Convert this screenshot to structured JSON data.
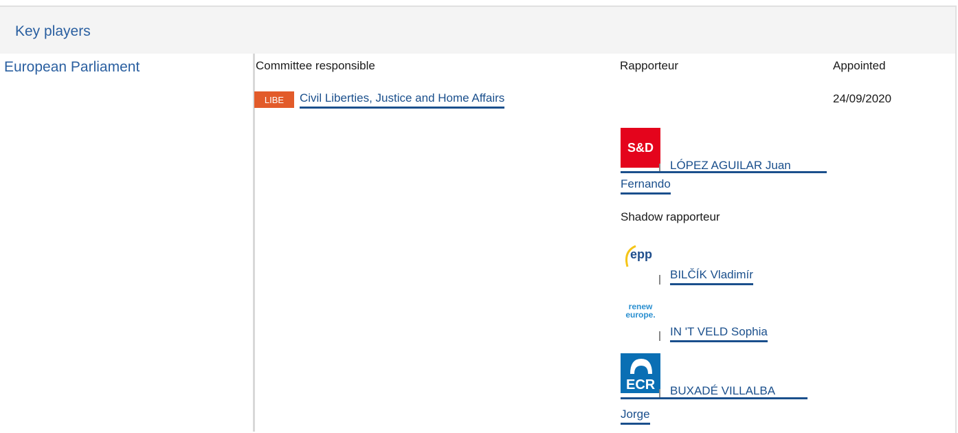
{
  "header": {
    "title": "Key players"
  },
  "institution": "European Parliament",
  "columns": {
    "committee": "Committee responsible",
    "rapporteur": "Rapporteur",
    "appointed": "Appointed"
  },
  "committee": {
    "code": "LIBE",
    "name": "Civil Liberties, Justice and Home Affairs",
    "appointed_date": "24/09/2020"
  },
  "rapporteur": {
    "group_logo": "S&D",
    "name_line1": "LÓPEZ AGUILAR Juan",
    "name_line2": "Fernando"
  },
  "shadow_label": "Shadow rapporteur",
  "shadows": [
    {
      "group": "epp",
      "name": "BILČÍK Vladimír"
    },
    {
      "group_line1": "renew",
      "group_line2": "europe.",
      "name": "IN 'T VELD Sophia"
    },
    {
      "group": "ECR",
      "name_line1": "BUXADÉ VILLALBA",
      "name_line2": "Jorge"
    }
  ],
  "colors": {
    "link": "#1a4f8c",
    "libe_badge": "#e25b2a",
    "sd_red": "#e4041c",
    "ecr_blue": "#0a6fb4",
    "renew_blue": "#2a8fd0"
  }
}
